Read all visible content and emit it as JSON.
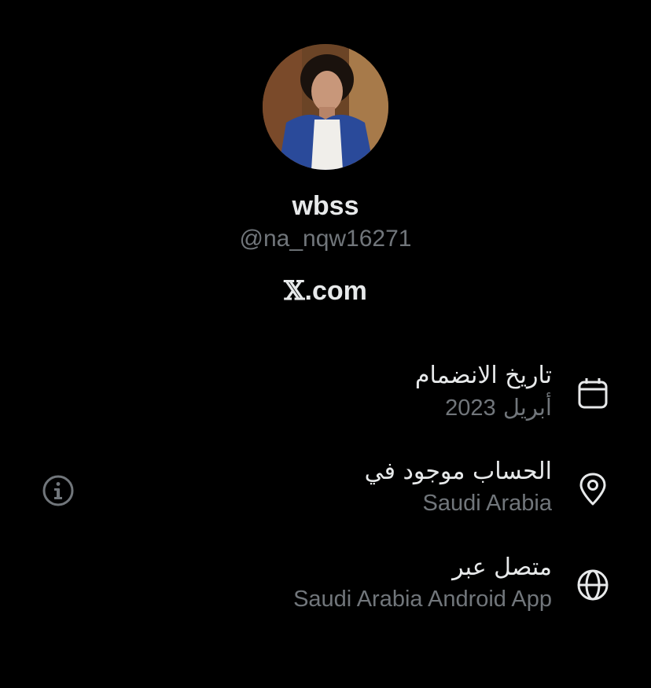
{
  "profile": {
    "display_name": "wbss",
    "handle": "@na_nqw16271",
    "avatar": "profile-photo"
  },
  "brand": {
    "x_mark": "𝕏",
    "suffix": ".com"
  },
  "details": [
    {
      "label": "تاريخ الانضمام",
      "value_month": "أبريل",
      "value_year": "2023",
      "icon": "calendar-icon"
    },
    {
      "label": "الحساب موجود في",
      "value": "Saudi Arabia",
      "icon": "location-pin-icon"
    },
    {
      "label": "متصل عبر",
      "value": "Saudi Arabia Android App",
      "icon": "globe-icon"
    }
  ],
  "info_icon": "info-icon",
  "colors": {
    "background": "#000000",
    "primary_text": "#e7e9ea",
    "secondary_text": "#71767b"
  }
}
